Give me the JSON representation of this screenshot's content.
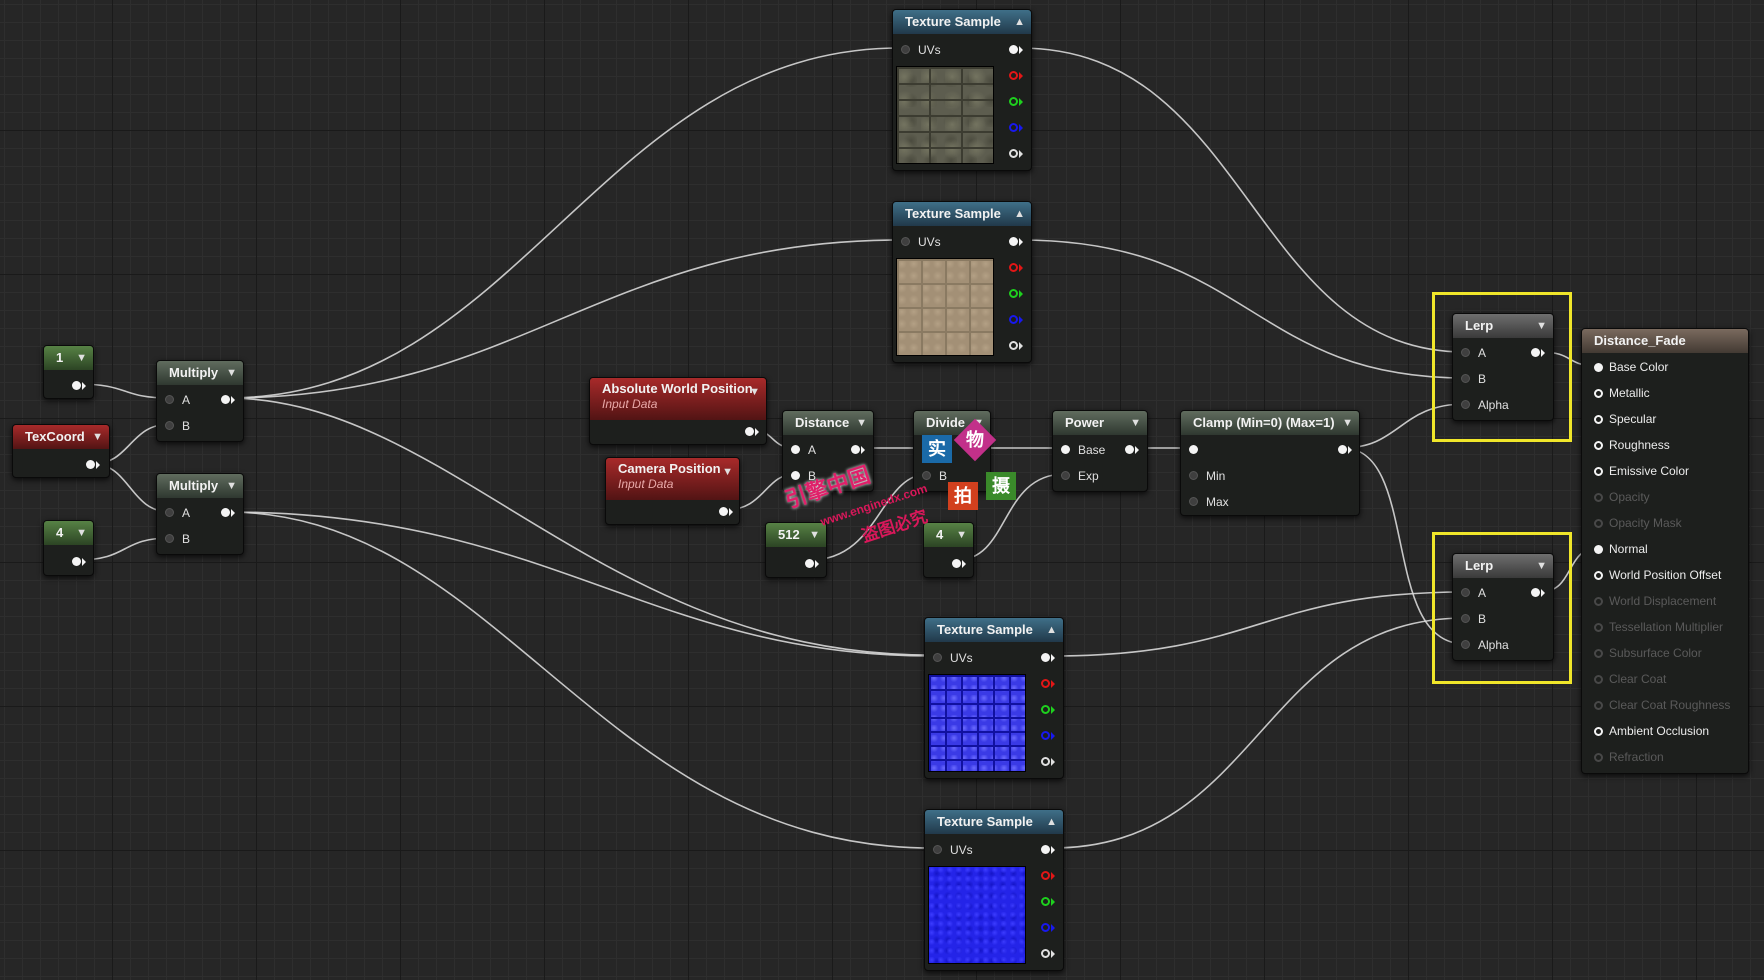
{
  "nodes": {
    "const_1": {
      "value": "1"
    },
    "texcoord": {
      "title": "TexCoord"
    },
    "const_4_left": {
      "value": "4"
    },
    "multiply_1": {
      "title": "Multiply",
      "pin_a": "A",
      "pin_b": "B"
    },
    "multiply_2": {
      "title": "Multiply",
      "pin_a": "A",
      "pin_b": "B"
    },
    "abs_world_pos": {
      "title": "Absolute World Position",
      "subtitle": "Input Data"
    },
    "camera_pos": {
      "title": "Camera Position",
      "subtitle": "Input Data"
    },
    "distance": {
      "title": "Distance",
      "pin_a": "A",
      "pin_b": "B"
    },
    "const_512": {
      "value": "512"
    },
    "divide": {
      "title": "Divide",
      "pin_a": "A",
      "pin_b": "B"
    },
    "const_4_mid": {
      "value": "4"
    },
    "power": {
      "title": "Power",
      "pin_base": "Base",
      "pin_exp": "Exp"
    },
    "clamp": {
      "title": "Clamp (Min=0) (Max=1)",
      "pin_min": "Min",
      "pin_max": "Max"
    },
    "tex_1": {
      "title": "Texture Sample",
      "uvs": "UVs",
      "texture": "stone"
    },
    "tex_2": {
      "title": "Texture Sample",
      "uvs": "UVs",
      "texture": "sand"
    },
    "tex_3": {
      "title": "Texture Sample",
      "uvs": "UVs",
      "texture": "brick-normal"
    },
    "tex_4": {
      "title": "Texture Sample",
      "uvs": "UVs",
      "texture": "flat-normal"
    },
    "lerp_1": {
      "title": "Lerp",
      "pin_a": "A",
      "pin_b": "B",
      "pin_alpha": "Alpha",
      "selected": true
    },
    "lerp_2": {
      "title": "Lerp",
      "pin_a": "A",
      "pin_b": "B",
      "pin_alpha": "Alpha",
      "selected": true
    }
  },
  "result": {
    "title": "Distance_Fade",
    "inputs": [
      {
        "label": "Base Color",
        "enabled": true,
        "connected": true
      },
      {
        "label": "Metallic",
        "enabled": true,
        "connected": false
      },
      {
        "label": "Specular",
        "enabled": true,
        "connected": false
      },
      {
        "label": "Roughness",
        "enabled": true,
        "connected": false
      },
      {
        "label": "Emissive Color",
        "enabled": true,
        "connected": false
      },
      {
        "label": "Opacity",
        "enabled": false,
        "connected": false
      },
      {
        "label": "Opacity Mask",
        "enabled": false,
        "connected": false
      },
      {
        "label": "Normal",
        "enabled": true,
        "connected": true
      },
      {
        "label": "World Position Offset",
        "enabled": true,
        "connected": false
      },
      {
        "label": "World Displacement",
        "enabled": false,
        "connected": false
      },
      {
        "label": "Tessellation Multiplier",
        "enabled": false,
        "connected": false
      },
      {
        "label": "Subsurface Color",
        "enabled": false,
        "connected": false
      },
      {
        "label": "Clear Coat",
        "enabled": false,
        "connected": false
      },
      {
        "label": "Clear Coat Roughness",
        "enabled": false,
        "connected": false
      },
      {
        "label": "Ambient Occlusion",
        "enabled": true,
        "connected": false
      },
      {
        "label": "Refraction",
        "enabled": false,
        "connected": false
      }
    ]
  },
  "watermark": {
    "line1": "引擎中国",
    "url": "www.enginedx.com",
    "line2": "盗图必究",
    "badges": [
      "实",
      "物",
      "拍",
      "摄"
    ]
  },
  "colors": {
    "grid_bg": "#262626",
    "selection": "#f0e62a",
    "wire": "#d8d8d8",
    "pin_red": "#e21616",
    "pin_green": "#1ed01e",
    "pin_blue": "#1818ee"
  }
}
